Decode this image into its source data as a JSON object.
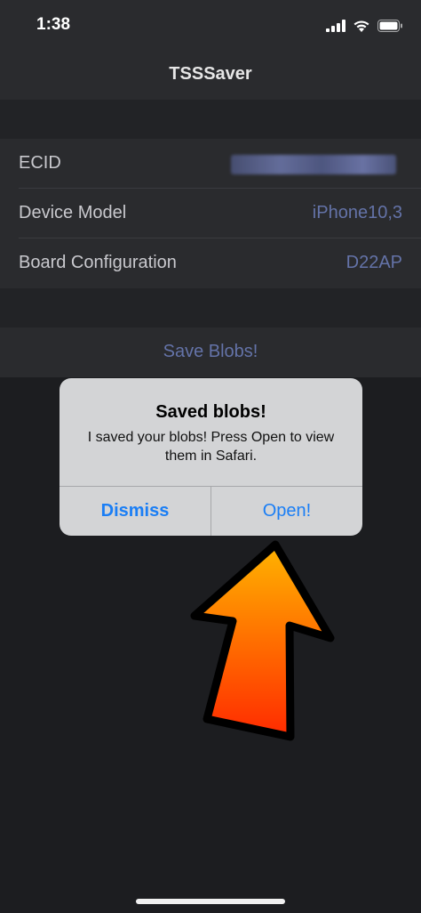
{
  "status_bar": {
    "time": "1:38"
  },
  "nav": {
    "title": "TSSSaver"
  },
  "device_info": {
    "rows": [
      {
        "label": "ECID",
        "value": ""
      },
      {
        "label": "Device Model",
        "value": "iPhone10,3"
      },
      {
        "label": "Board Configuration",
        "value": "D22AP"
      }
    ]
  },
  "save": {
    "label": "Save Blobs!"
  },
  "alert": {
    "title": "Saved blobs!",
    "message": "I saved your blobs! Press Open to view them in Safari.",
    "dismiss_label": "Dismiss",
    "open_label": "Open!"
  },
  "colors": {
    "accent_blue": "#1a7ef5",
    "value_blue": "#6473a8",
    "arrow_top": "#ffb400",
    "arrow_bottom": "#ff2a00"
  }
}
